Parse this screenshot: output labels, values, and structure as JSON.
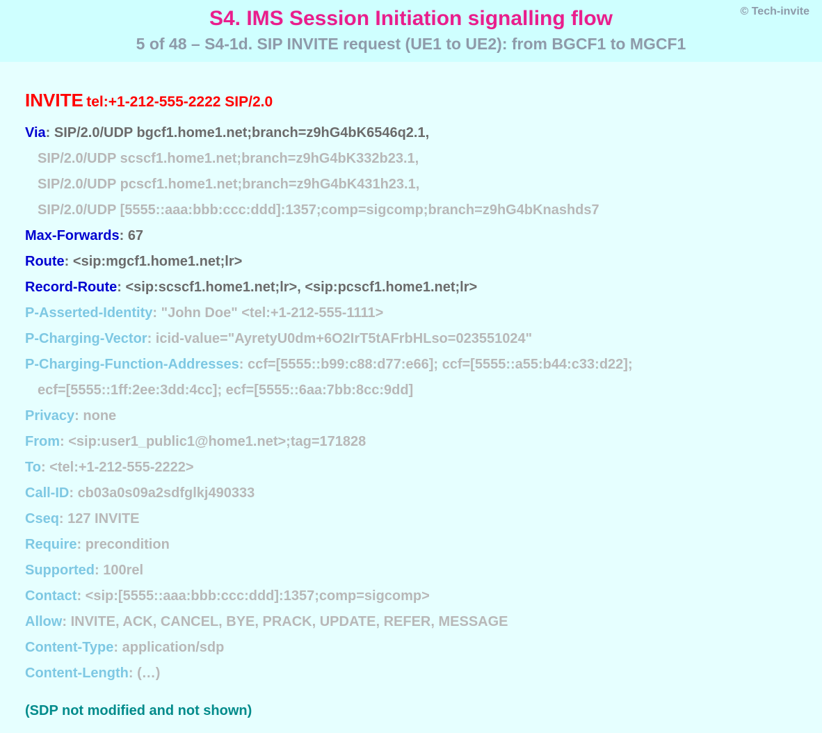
{
  "copyright": "© Tech-invite",
  "title": "S4. IMS Session Initiation signalling flow",
  "subtitle": "5 of 48 – S4-1d. SIP INVITE request (UE1 to UE2): from BGCF1 to MGCF1",
  "request": {
    "method": "INVITE",
    "uri": "tel:+1-212-555-2222 SIP/2.0"
  },
  "headers": {
    "via": {
      "name": "Via",
      "first": "SIP/2.0/UDP bgcf1.home1.net;branch=z9hG4bK6546q2.1,",
      "cont": [
        "SIP/2.0/UDP scscf1.home1.net;branch=z9hG4bK332b23.1,",
        "SIP/2.0/UDP pcscf1.home1.net;branch=z9hG4bK431h23.1,",
        "SIP/2.0/UDP [5555::aaa:bbb:ccc:ddd]:1357;comp=sigcomp;branch=z9hG4bKnashds7"
      ]
    },
    "maxforwards": {
      "name": "Max-Forwards",
      "value": "67"
    },
    "route": {
      "name": "Route",
      "value": "<sip:mgcf1.home1.net;lr>"
    },
    "recordroute": {
      "name": "Record-Route",
      "value": "<sip:scscf1.home1.net;lr>, <sip:pcscf1.home1.net;lr>"
    },
    "pai": {
      "name": "P-Asserted-Identity",
      "value": "\"John Doe\" <tel:+1-212-555-1111>"
    },
    "pcv": {
      "name": "P-Charging-Vector",
      "value": "icid-value=\"AyretyU0dm+6O2IrT5tAFrbHLso=023551024\""
    },
    "pcfa": {
      "name": "P-Charging-Function-Addresses",
      "first": "ccf=[5555::b99:c88:d77:e66]; ccf=[5555::a55:b44:c33:d22];",
      "cont": "ecf=[5555::1ff:2ee:3dd:4cc]; ecf=[5555::6aa:7bb:8cc:9dd]"
    },
    "privacy": {
      "name": "Privacy",
      "value": "none"
    },
    "from": {
      "name": "From",
      "value": "<sip:user1_public1@home1.net>;tag=171828"
    },
    "to": {
      "name": "To",
      "value": "<tel:+1-212-555-2222>"
    },
    "callid": {
      "name": "Call-ID",
      "value": "cb03a0s09a2sdfglkj490333"
    },
    "cseq": {
      "name": "Cseq",
      "value": "127 INVITE"
    },
    "require": {
      "name": "Require",
      "value": "precondition"
    },
    "supported": {
      "name": "Supported",
      "value": "100rel"
    },
    "contact": {
      "name": "Contact",
      "value": "<sip:[5555::aaa:bbb:ccc:ddd]:1357;comp=sigcomp>"
    },
    "allow": {
      "name": "Allow",
      "value": "INVITE, ACK, CANCEL, BYE, PRACK, UPDATE, REFER, MESSAGE"
    },
    "contenttype": {
      "name": "Content-Type",
      "value": "application/sdp"
    },
    "contentlength": {
      "name": "Content-Length",
      "value": "(…)"
    }
  },
  "sdpnote": "(SDP not modified and not shown)"
}
